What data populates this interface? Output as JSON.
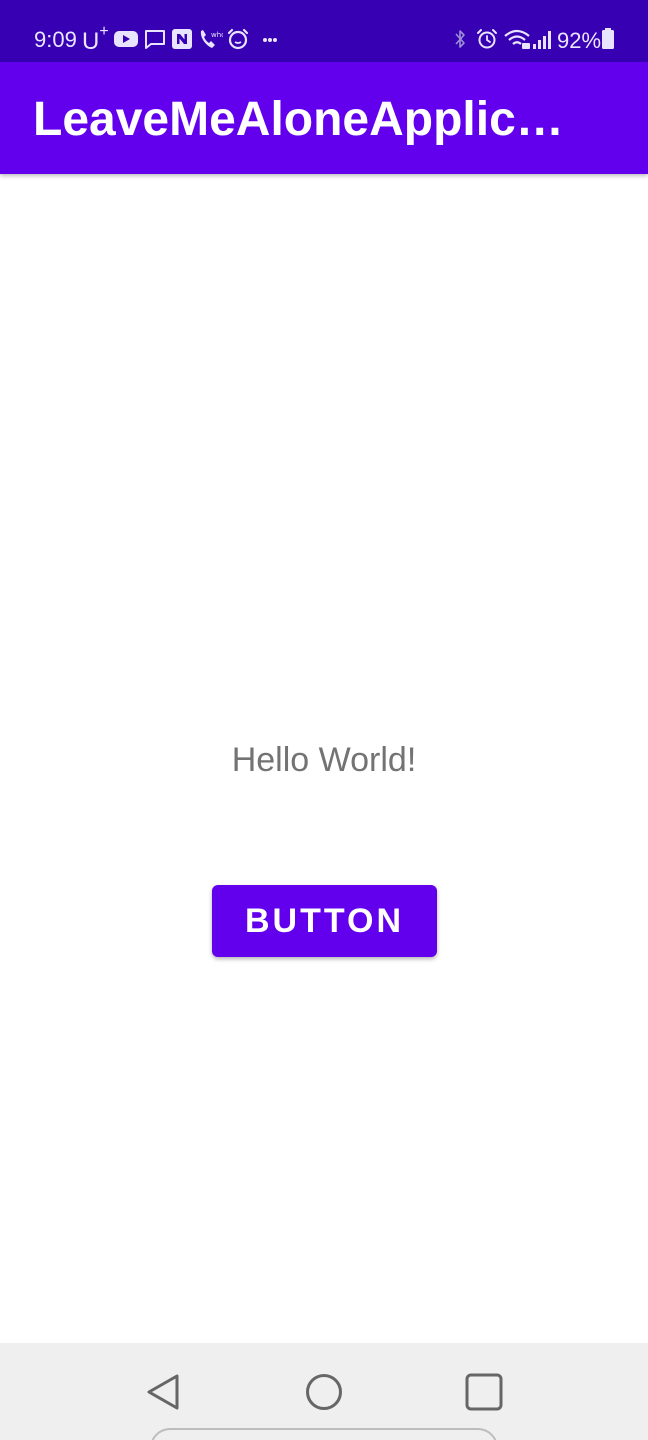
{
  "status_bar": {
    "time": "9:09",
    "carrier": "U",
    "carrier_plus": "+",
    "battery_percent": "92%",
    "background_color": "#3700b3",
    "left_icons": [
      "youtube-icon",
      "message-icon",
      "naver-icon",
      "whowho-call-icon",
      "alarm-app-icon",
      "more-notifications-icon"
    ],
    "right_icons": [
      "bluetooth-icon",
      "alarm-icon",
      "wifi-icon",
      "signal-icon",
      "battery-icon"
    ]
  },
  "app_bar": {
    "title": "LeaveMeAloneApplic…",
    "background_color": "#6200ee"
  },
  "content": {
    "hello_text": "Hello World!",
    "button_label": "BUTTON",
    "button_color": "#6200ee"
  },
  "nav_bar": {
    "buttons": [
      "back-icon",
      "home-icon",
      "recents-icon"
    ],
    "background_color": "#efefef"
  }
}
